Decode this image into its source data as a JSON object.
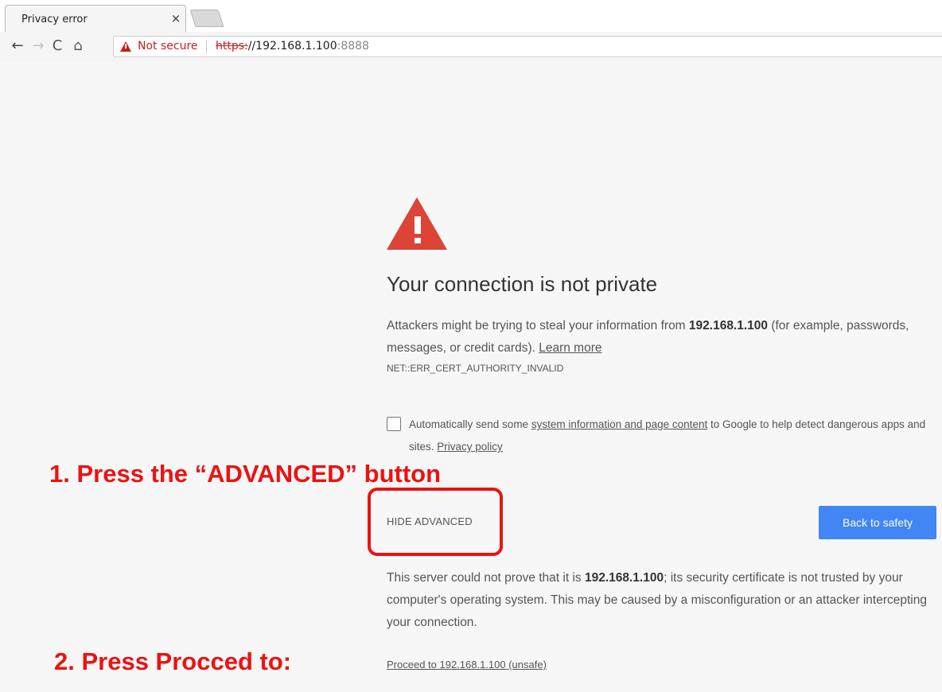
{
  "tab": {
    "title": "Privacy error",
    "close": "×"
  },
  "nav": {
    "back": "←",
    "forward": "→",
    "reload": "C",
    "home": "⌂"
  },
  "omnibox": {
    "security_label": "Not secure",
    "url_scheme": "https:",
    "url_host": "//192.168.1.100",
    "url_port": ":8888"
  },
  "page": {
    "heading": "Your connection is not private",
    "intro_before": "Attackers might be trying to steal your information from ",
    "intro_host": "192.168.1.100",
    "intro_after": " (for example, passwords, messages, or credit cards). ",
    "learn_more": "Learn more",
    "error_code": "NET::ERR_CERT_AUTHORITY_INVALID",
    "optin_before": "Automatically send some ",
    "optin_link": "system information and page content",
    "optin_after": " to Google to help detect dangerous apps and sites. ",
    "privacy_policy": "Privacy policy",
    "hide_advanced": "HIDE ADVANCED",
    "back_to_safety": "Back to safety",
    "details_before": "This server could not prove that it is ",
    "details_host": "192.168.1.100",
    "details_after": "; its security certificate is not trusted by your computer's operating system. This may be caused by a misconfiguration or an attacker intercepting your connection.",
    "proceed_link": "Proceed to 192.168.1.100 (unsafe)"
  },
  "annotations": {
    "step1": "1. Press the “ADVANCED” button",
    "step2": "2. Press Procced to:"
  },
  "colors": {
    "warning_red": "#db4437",
    "button_blue": "#4285f4",
    "annotation_red": "#ee1111"
  }
}
